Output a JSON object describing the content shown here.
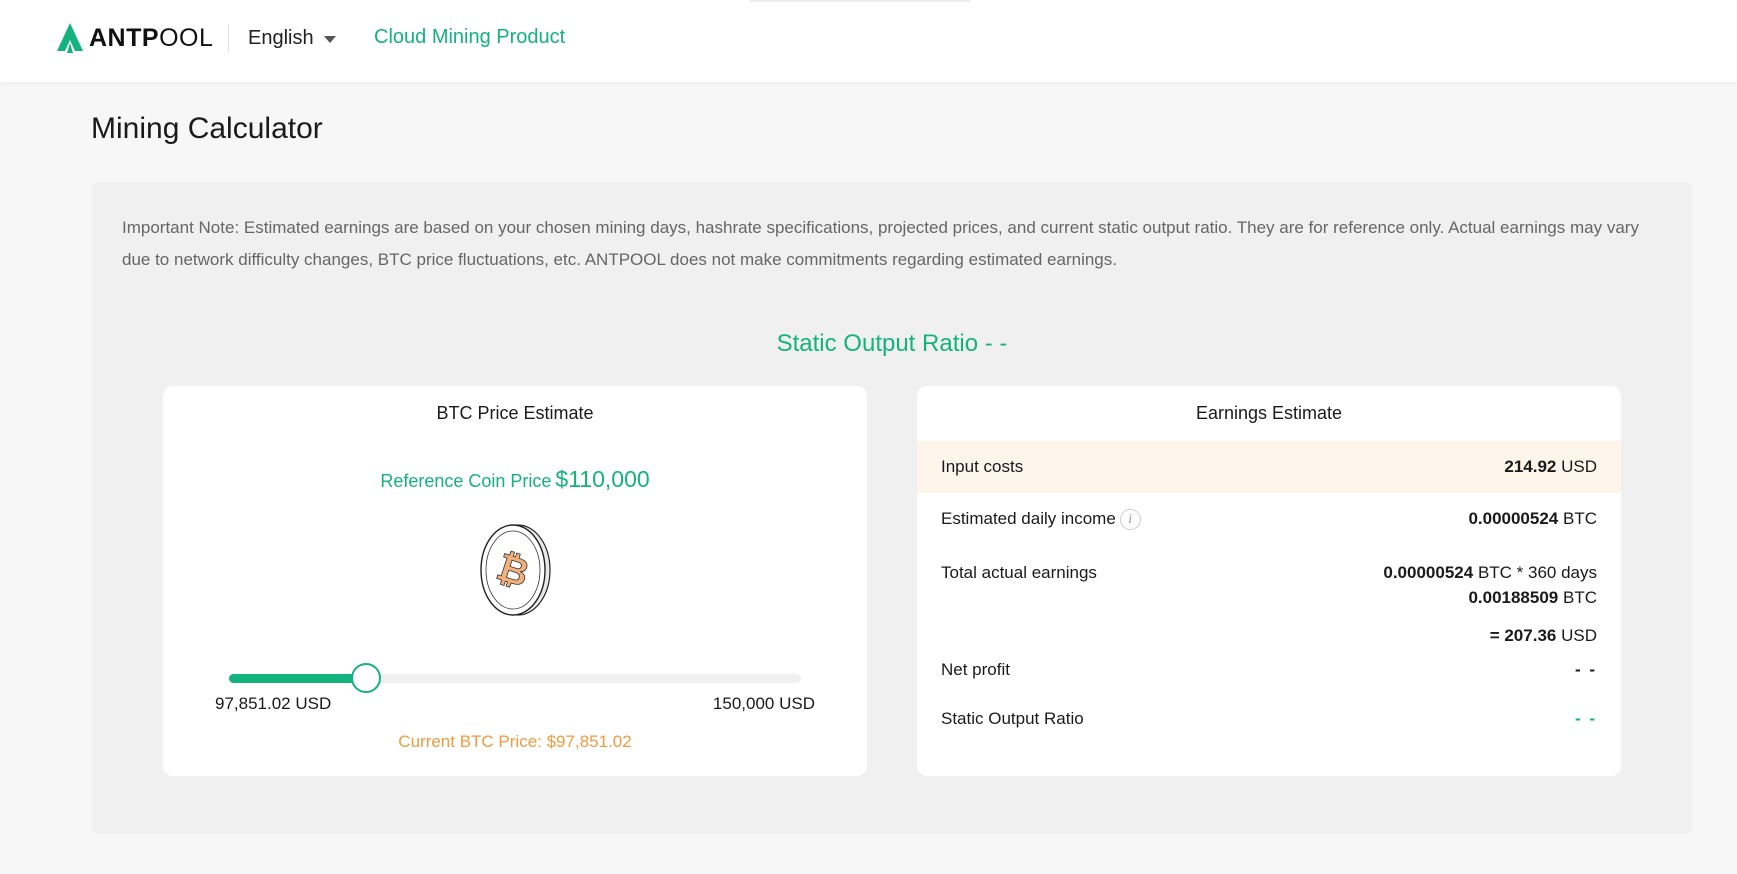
{
  "header": {
    "logo_bold": "ANTP",
    "logo_light": "OOL",
    "language": "English",
    "nav_link": "Cloud Mining Product"
  },
  "page": {
    "title": "Mining Calculator",
    "note": "Important Note: Estimated earnings are based on your chosen mining days, hashrate specifications, projected prices, and current static output ratio. They are for reference only. Actual earnings may vary due to network difficulty changes, BTC price fluctuations, etc. ANTPOOL does not make commitments regarding estimated earnings.",
    "ratio_heading": "Static Output Ratio - -"
  },
  "price_card": {
    "title": "BTC Price Estimate",
    "ref_label": "Reference Coin Price",
    "ref_value": "$110,000",
    "slider_min": "97,851.02 USD",
    "slider_max": "150,000 USD",
    "slider_fraction": 0.24,
    "current_price": "Current BTC Price: $97,851.02"
  },
  "earnings_card": {
    "title": "Earnings Estimate",
    "input_costs_label": "Input costs",
    "input_costs_value": "214.92",
    "input_costs_unit": "USD",
    "daily_income_label": "Estimated daily income",
    "daily_income_value": "0.00000524",
    "daily_income_unit": "BTC",
    "total_label": "Total actual earnings",
    "total_value": "0.00000524",
    "total_unit": "BTC * 360 days",
    "total_btc_value": "0.00188509",
    "total_btc_unit": "BTC",
    "total_usd_value": "= 207.36",
    "total_usd_unit": "USD",
    "net_profit_label": "Net profit",
    "net_profit_value": "- -",
    "static_ratio_label": "Static Output Ratio",
    "static_ratio_value": "- -"
  },
  "colors": {
    "brand_green": "#14b37d",
    "price_orange": "#f29a3f",
    "highlight_row": "#fdf4ea"
  }
}
